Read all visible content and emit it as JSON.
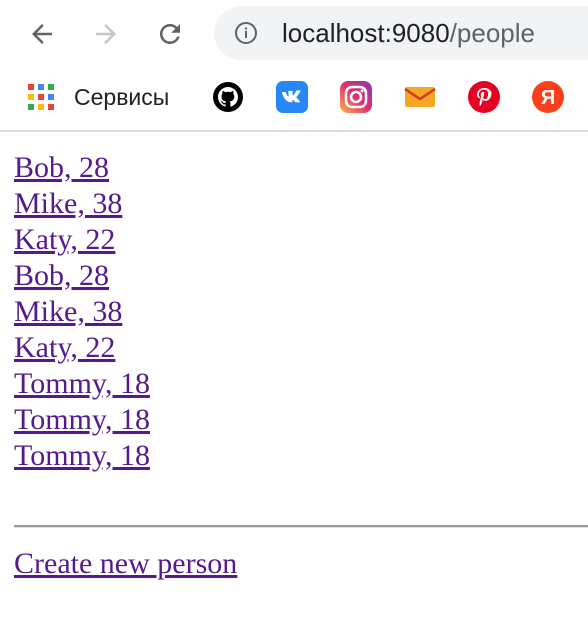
{
  "browser": {
    "url_host": "localhost:9080",
    "url_path": "/people"
  },
  "bookmarks": {
    "apps_label": "Сервисы",
    "items": [
      {
        "icon": "github-icon",
        "color": "#000000"
      },
      {
        "icon": "vk-icon",
        "color": "#2787f5"
      },
      {
        "icon": "instagram-icon",
        "color": "#c13584"
      },
      {
        "icon": "mail-icon",
        "color": "#f5a623"
      },
      {
        "icon": "pinterest-icon",
        "color": "#e60023"
      },
      {
        "icon": "yandex-icon",
        "color": "#fc3f1d"
      }
    ]
  },
  "people": [
    {
      "label": "Bob, 28"
    },
    {
      "label": "Mike, 38"
    },
    {
      "label": "Katy, 22"
    },
    {
      "label": "Bob, 28"
    },
    {
      "label": "Mike, 38"
    },
    {
      "label": "Katy, 22"
    },
    {
      "label": "Tommy, 18"
    },
    {
      "label": "Tommy, 18"
    },
    {
      "label": "Tommy, 18"
    }
  ],
  "create_link": "Create new person",
  "colors": {
    "link_visited": "#551a8b"
  }
}
